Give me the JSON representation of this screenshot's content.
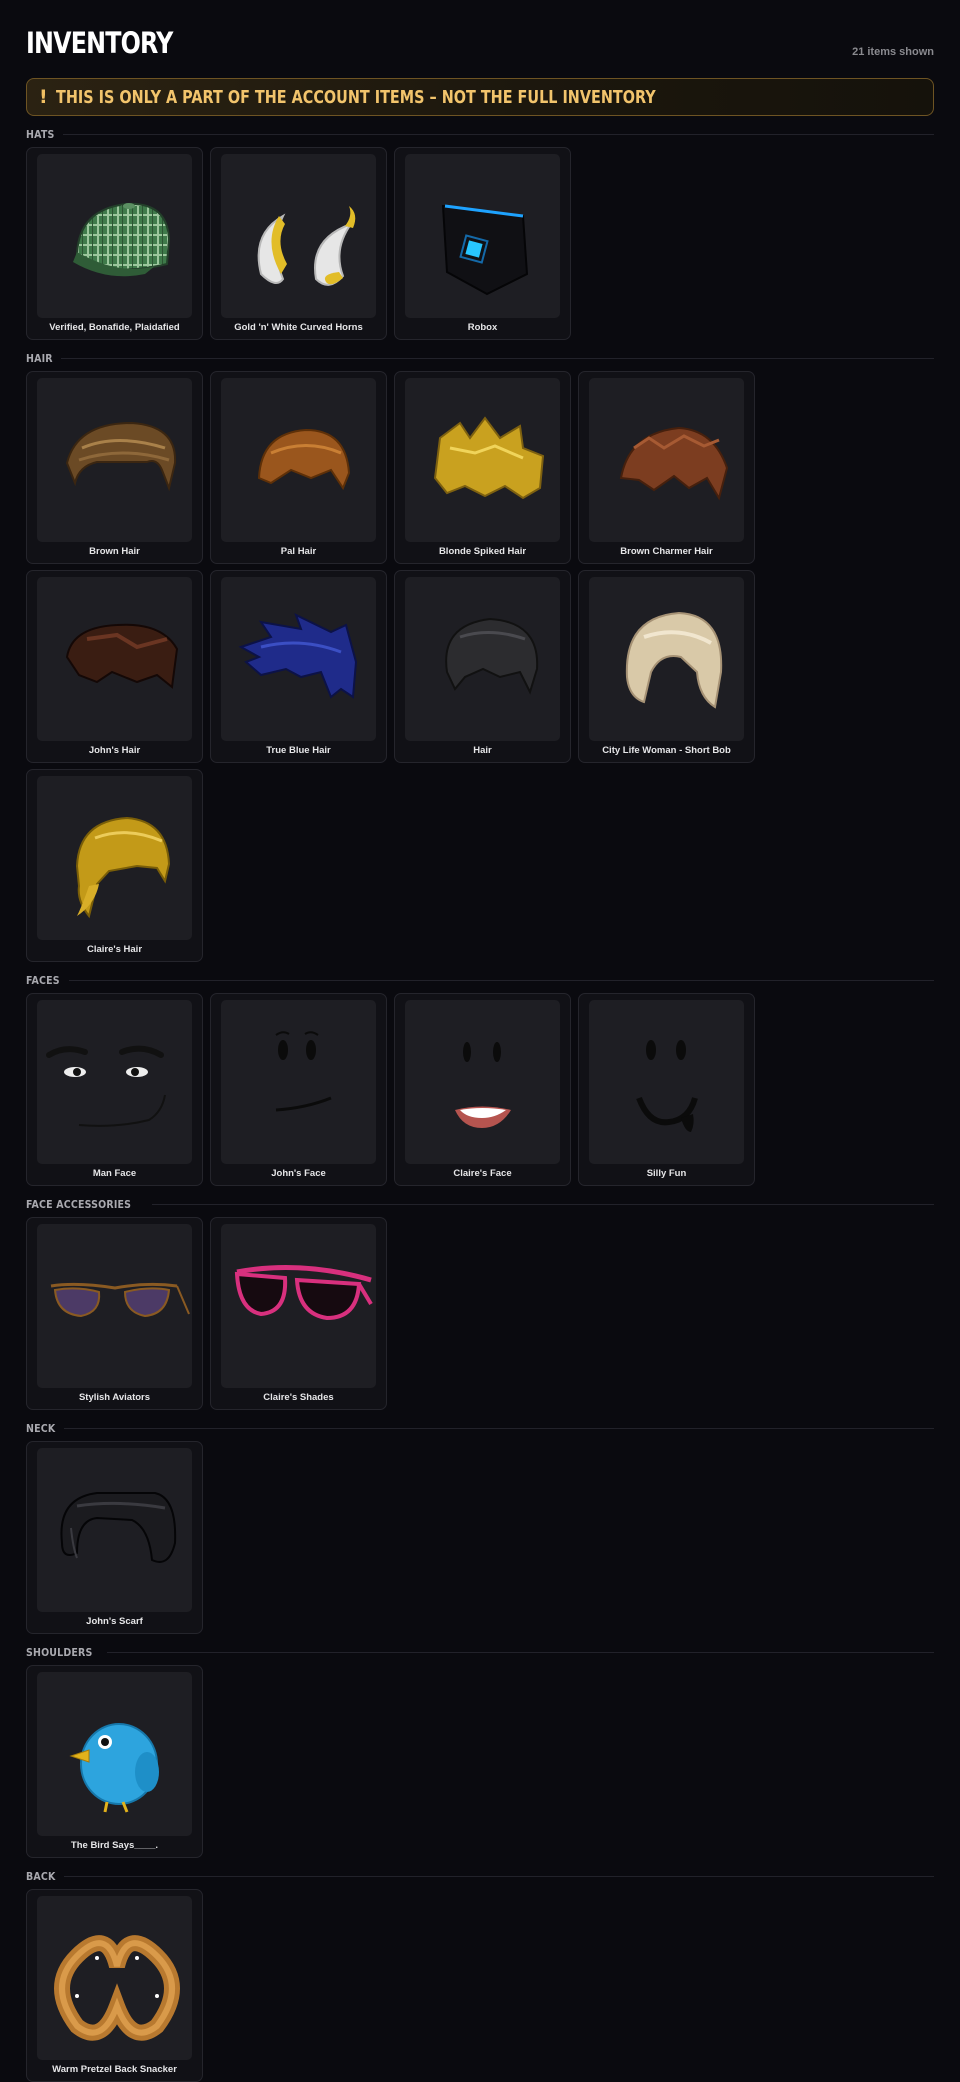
{
  "header": {
    "title": "INVENTORY",
    "count": "21 items shown"
  },
  "banner": {
    "icon": "!",
    "text": "THIS IS ONLY A PART OF THE ACCOUNT ITEMS – NOT THE FULL INVENTORY"
  },
  "sections": [
    {
      "title": "HATS",
      "items": [
        {
          "name": "Verified, Bonafide, Plaidafied",
          "icon": "plaid-cap-icon"
        },
        {
          "name": "Gold 'n' White Curved Horns",
          "icon": "curved-horns-icon"
        },
        {
          "name": "Robox",
          "icon": "robox-icon"
        }
      ]
    },
    {
      "title": "HAIR",
      "items": [
        {
          "name": "Brown Hair",
          "icon": "brown-hair-icon"
        },
        {
          "name": "Pal Hair",
          "icon": "pal-hair-icon"
        },
        {
          "name": "Blonde Spiked Hair",
          "icon": "blonde-spiked-hair-icon"
        },
        {
          "name": "Brown Charmer Hair",
          "icon": "brown-charmer-hair-icon"
        },
        {
          "name": "John's Hair",
          "icon": "johns-hair-icon"
        },
        {
          "name": "True Blue Hair",
          "icon": "true-blue-hair-icon"
        },
        {
          "name": "Hair",
          "icon": "black-hair-icon"
        },
        {
          "name": "City Life Woman - Short Bob",
          "icon": "short-bob-hair-icon"
        },
        {
          "name": "Claire's Hair",
          "icon": "claires-hair-icon"
        }
      ]
    },
    {
      "title": "FACES",
      "items": [
        {
          "name": "Man Face",
          "icon": "man-face-icon"
        },
        {
          "name": "John's Face",
          "icon": "johns-face-icon"
        },
        {
          "name": "Claire's Face",
          "icon": "claires-face-icon"
        },
        {
          "name": "Silly Fun",
          "icon": "silly-fun-face-icon"
        }
      ]
    },
    {
      "title": "FACE ACCESSORIES",
      "items": [
        {
          "name": "Stylish Aviators",
          "icon": "aviator-sunglasses-icon"
        },
        {
          "name": "Claire's Shades",
          "icon": "pink-shades-icon"
        }
      ]
    },
    {
      "title": "NECK",
      "items": [
        {
          "name": "John's Scarf",
          "icon": "black-scarf-icon"
        }
      ]
    },
    {
      "title": "SHOULDERS",
      "items": [
        {
          "name": "The Bird Says____.",
          "icon": "blue-bird-icon"
        }
      ]
    },
    {
      "title": "BACK",
      "items": [
        {
          "name": "Warm Pretzel Back Snacker",
          "icon": "pretzel-icon"
        }
      ]
    }
  ]
}
